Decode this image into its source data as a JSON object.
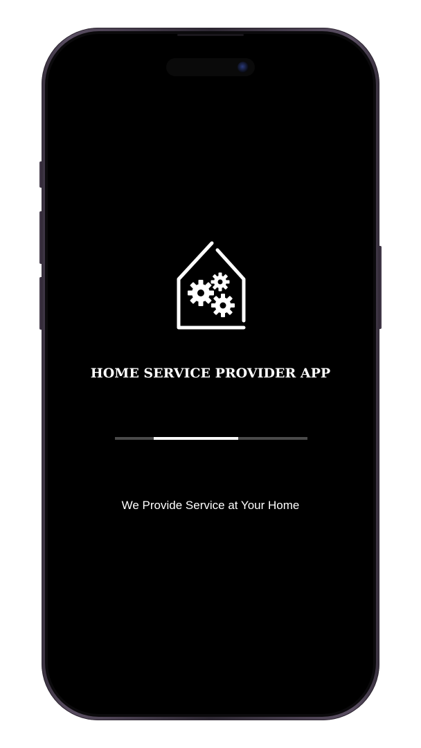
{
  "app": {
    "title": "HOME SERVICE PROVIDER APP",
    "tagline": "We Provide Service at Your Home",
    "logo_icon": "house-with-gears-icon"
  },
  "loader": {
    "progress_start": 0.2,
    "progress_end": 0.64
  },
  "colors": {
    "screen_background": "#000000",
    "text": "#ffffff",
    "progress_track": "#4a4a4a",
    "progress_fill": "#ffffff"
  }
}
